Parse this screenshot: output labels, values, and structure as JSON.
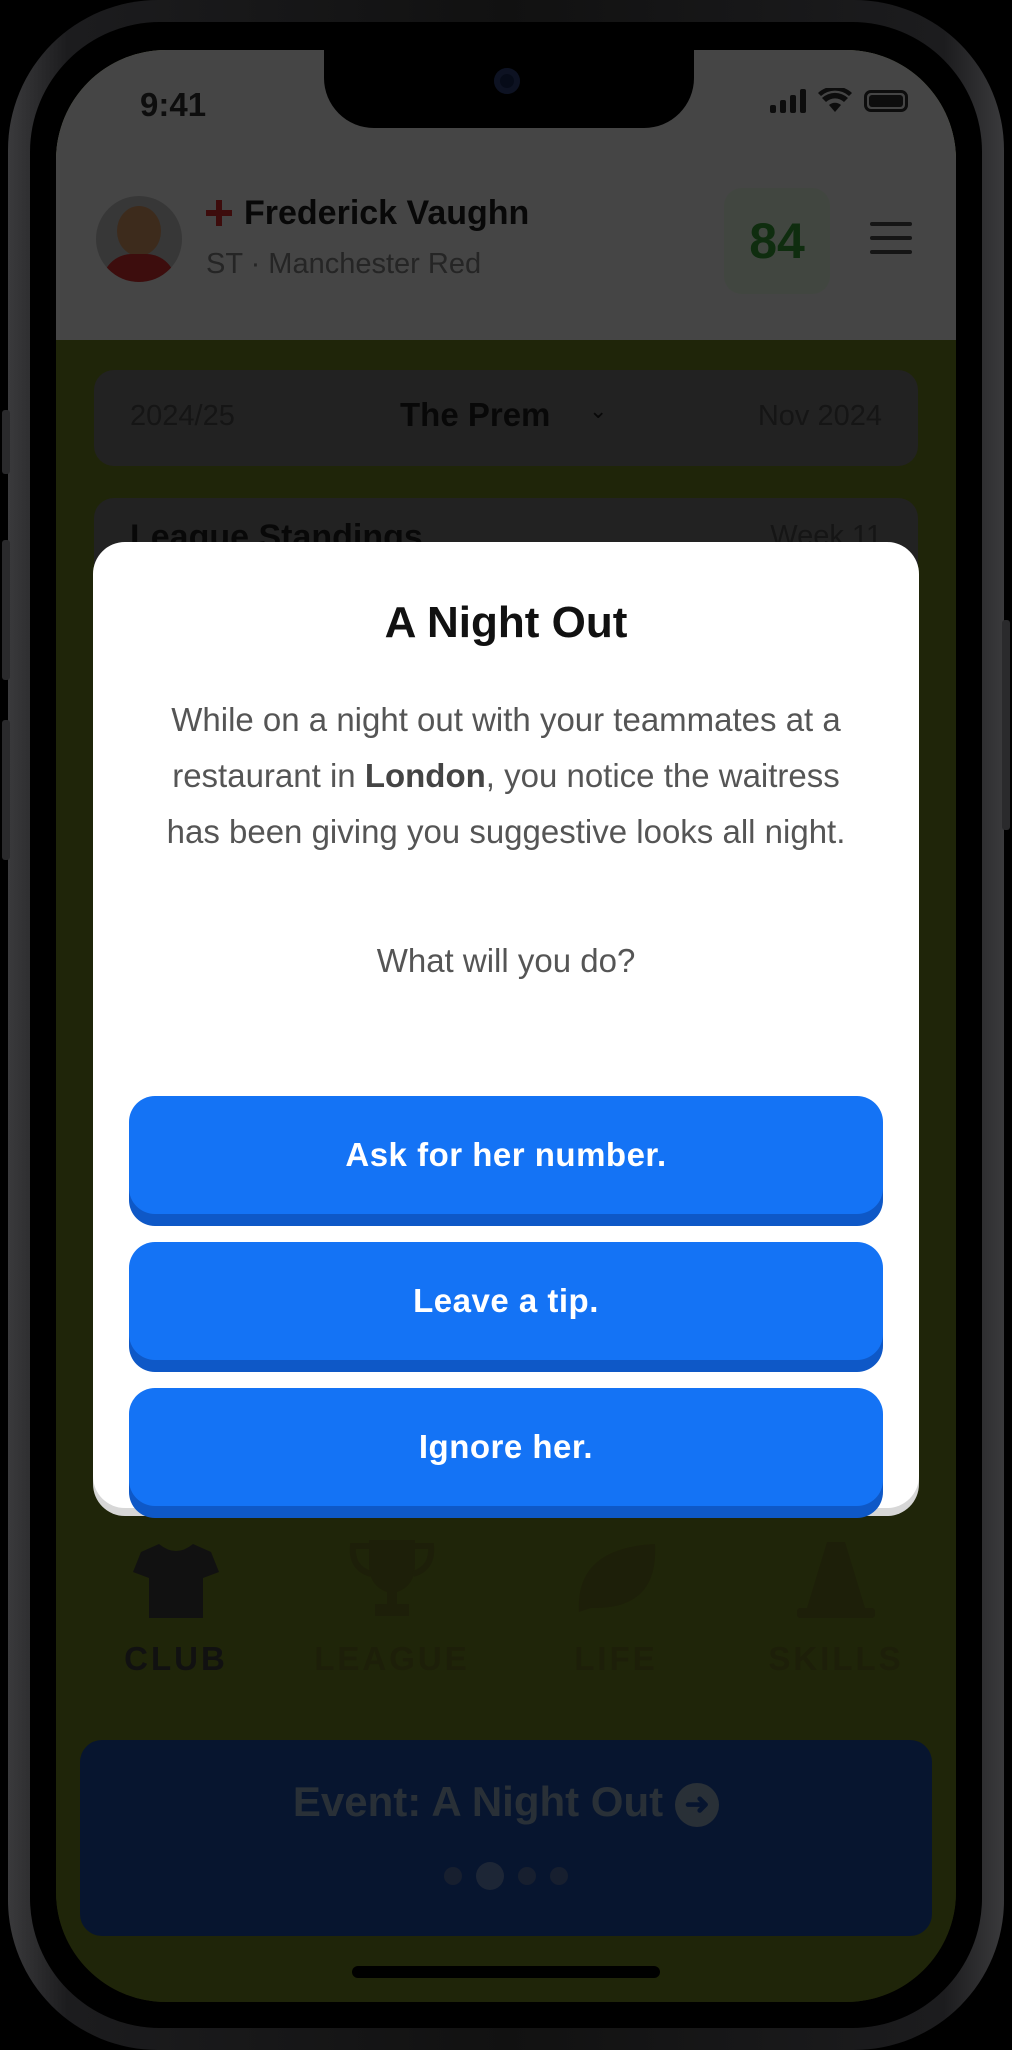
{
  "status_bar": {
    "time": "9:41"
  },
  "header": {
    "player_name": "Frederick Vaughn",
    "player_sub": "ST · Manchester Red",
    "rating": "84"
  },
  "season_bar": {
    "season": "2024/25",
    "league": "The Prem",
    "month": "Nov 2024"
  },
  "standings": {
    "title": "League Standings",
    "week": "Week 11"
  },
  "modal": {
    "title": "A Night Out",
    "body_part1": "While on a night out with your teammates at a restaurant in ",
    "body_bold": "London",
    "body_part2": ", you notice the waitress has been giving you suggestive looks all night.",
    "question": "What will you do?",
    "choices": [
      "Ask for her number.",
      "Leave a tip.",
      "Ignore her."
    ]
  },
  "nav": {
    "items": [
      {
        "label": "CLUB",
        "icon": "shirt-icon",
        "active": true
      },
      {
        "label": "LEAGUE",
        "icon": "trophy-icon",
        "active": false
      },
      {
        "label": "LIFE",
        "icon": "leaf-icon",
        "active": false
      },
      {
        "label": "SKILLS",
        "icon": "cone-icon",
        "active": false
      }
    ]
  },
  "event_banner": {
    "label": "Event: A Night Out",
    "pager_total": 4,
    "pager_active": 2
  },
  "colors": {
    "choice_button": "#1473F5",
    "choice_button_shadow": "#0E58C7",
    "modal_bg": "#FFFFFF"
  }
}
